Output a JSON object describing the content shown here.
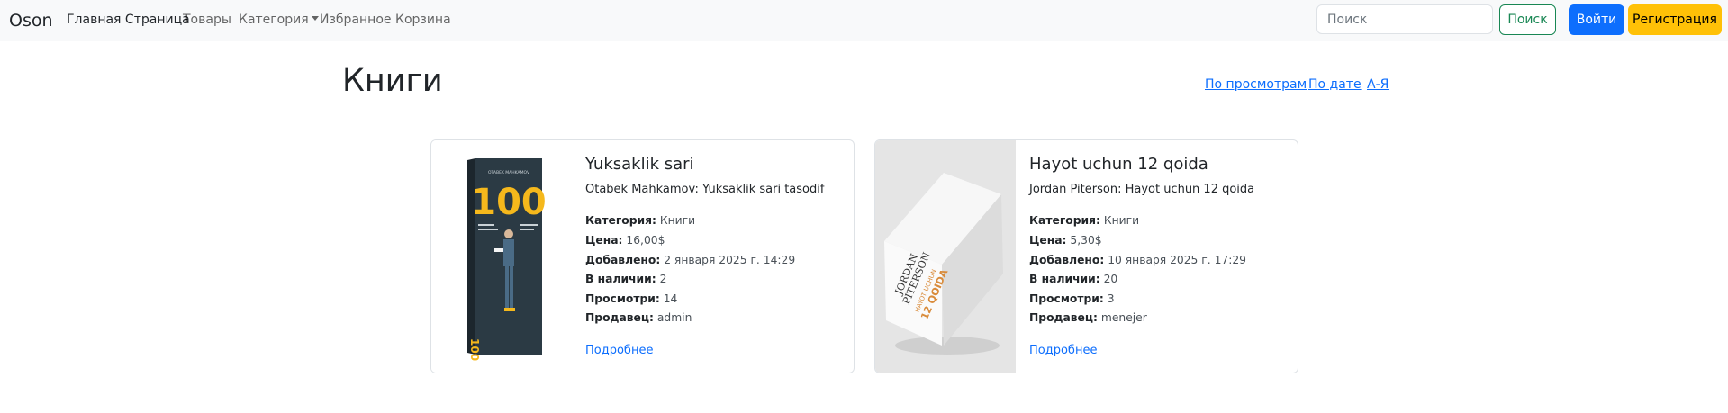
{
  "navbar": {
    "brand": "Oson",
    "links": [
      {
        "label": "Главная Страница",
        "active": true
      },
      {
        "label": "Товары",
        "active": false
      },
      {
        "label": "Категория",
        "active": false,
        "dropdown": true
      },
      {
        "label": "Избранное",
        "active": false
      },
      {
        "label": "Корзина",
        "active": false
      }
    ],
    "search": {
      "placeholder": "Поиск",
      "value": ""
    },
    "search_button": "Поиск",
    "login_button": "Войти",
    "register_button": "Регистрация"
  },
  "page": {
    "title": "Книги",
    "sort_links": [
      "По просмотрам",
      "По дате",
      "А-Я"
    ]
  },
  "cards": [
    {
      "title": "Yuksaklik sari",
      "subtitle": "Otabek Mahkamov: Yuksaklik sari tasodif",
      "fields": [
        {
          "label": "Категория:",
          "value": "Книги"
        },
        {
          "label": "Цена:",
          "value": "16,00$"
        },
        {
          "label": "Добавлено:",
          "value": "2 января 2025 г. 14:29"
        },
        {
          "label": "В наличии:",
          "value": "2"
        },
        {
          "label": "Просмотри:",
          "value": "14"
        },
        {
          "label": "Продавец:",
          "value": "admin"
        }
      ],
      "link": "Подробнее",
      "cover": {
        "text_big": "100",
        "text_top": "OTABEK MAHKAMOV",
        "colors": {
          "bg": "#2b3a44",
          "accent": "#f5b81c"
        }
      }
    },
    {
      "title": "Hayot uchun 12 qoida",
      "subtitle": "Jordan Piterson: Hayot uchun 12 qoida",
      "fields": [
        {
          "label": "Категория:",
          "value": "Книги"
        },
        {
          "label": "Цена:",
          "value": "5,30$"
        },
        {
          "label": "Добавлено:",
          "value": "10 января 2025 г. 17:29"
        },
        {
          "label": "В наличии:",
          "value": "20"
        },
        {
          "label": "Просмотри:",
          "value": "3"
        },
        {
          "label": "Продавец:",
          "value": "menejer"
        }
      ],
      "link": "Подробнее",
      "cover": {
        "text_author_1": "JORDAN",
        "text_author_2": "PITERSON",
        "text_title_1": "HAYOT UCHUN",
        "text_title_2": "12 QOIDA",
        "colors": {
          "bg": "#e5e5e5",
          "accent": "#d98b3a"
        }
      }
    }
  ],
  "colors": {
    "primary": "#0d6efd",
    "success": "#198754",
    "warning": "#ffc107",
    "navbar_bg": "#f8f9fa"
  }
}
